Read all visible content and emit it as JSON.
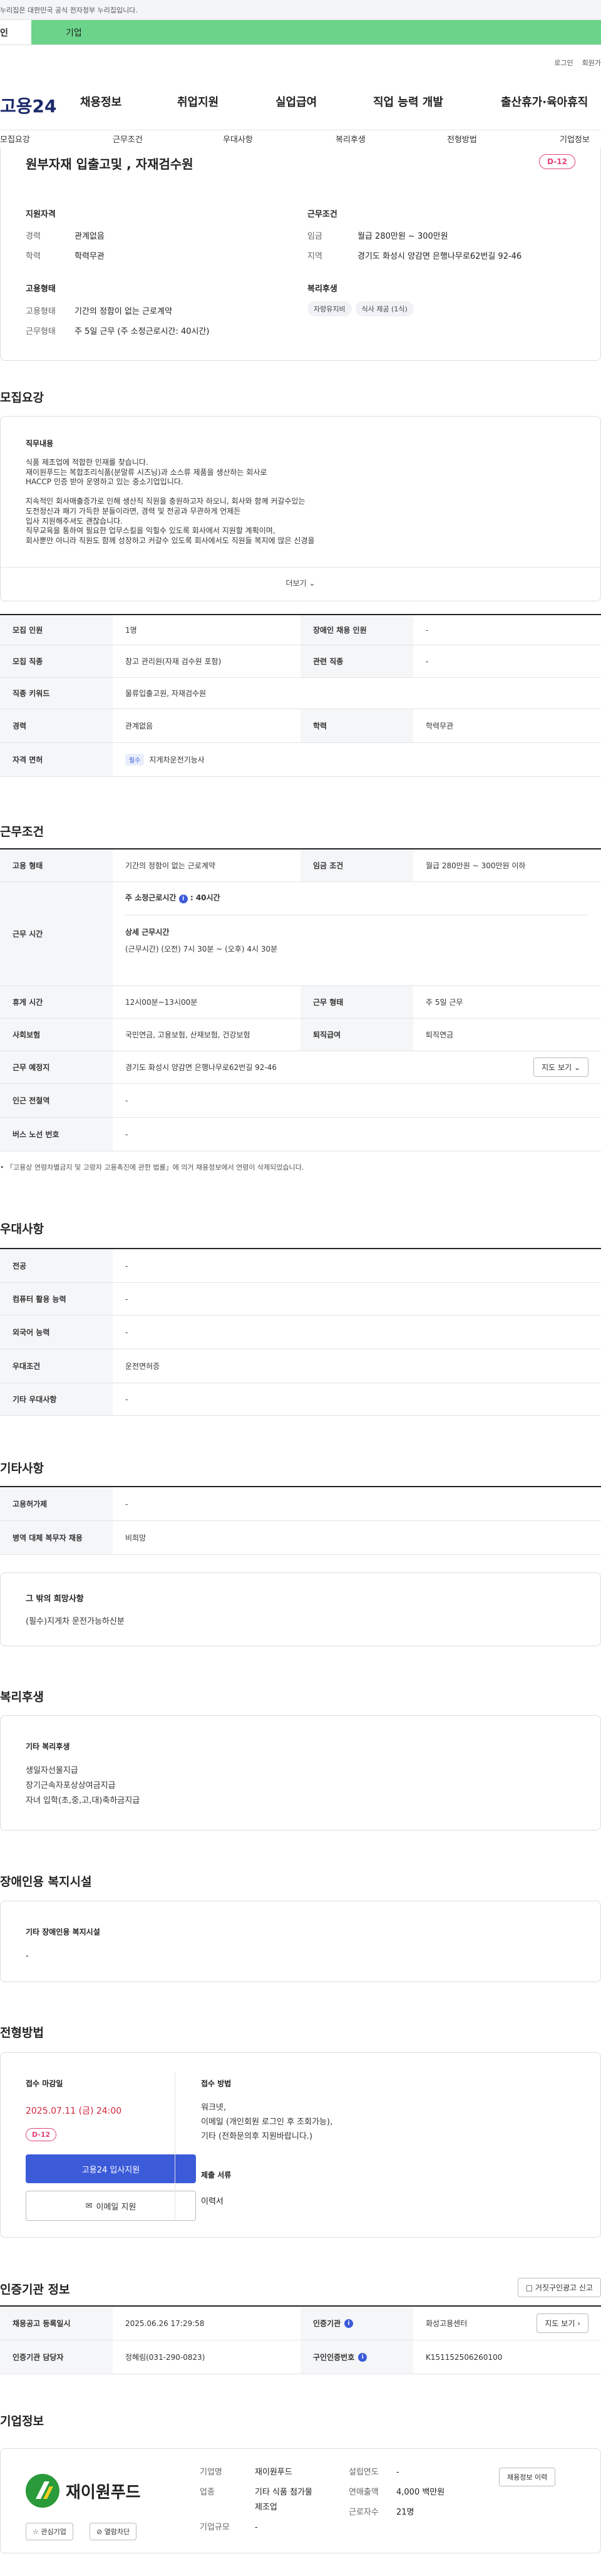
{
  "notice": "누리집은 대한민국 공식 전자정부 누리집입니다.",
  "gbar": {
    "tab_personal": "인",
    "tab_company": "기업"
  },
  "util": {
    "login": "로그인",
    "join": "회원가"
  },
  "gnb": {
    "logo": "고용24",
    "menu": [
      "채용정보",
      "취업지원",
      "실업급여",
      "직업 능력 개발",
      "출산휴가·육아휴직"
    ]
  },
  "tabs": [
    "모집요강",
    "근무조건",
    "우대사항",
    "복리후생",
    "전형방법",
    "기업정보"
  ],
  "job": {
    "title": "원부자재 입출고및 , 자재검수원",
    "dday": "D-12",
    "qual_title": "지원자격",
    "exp_label": "경력",
    "exp_value": "관계없음",
    "edu_label": "학력",
    "edu_value": "학력무관",
    "cond_title": "근무조건",
    "pay_label": "임금",
    "pay_value": "월급 280만원 ~ 300만원",
    "area_label": "지역",
    "area_value": "경기도 화성시 양감면 은행나무로62번길 92-46",
    "emp_title": "고용형태",
    "emptype_label": "고용형태",
    "emptype_value": "기간의 정함이 없는 근로계약",
    "worktype_label": "근무형태",
    "worktype_value": "주 5일 근무 (주 소정근로시간: 40시간)",
    "welfare_title": "복리후생",
    "welfare_chips": [
      "자량유지비",
      "식사 제공 (1식)"
    ]
  },
  "recruit": {
    "title": "모집요강",
    "duty_title": "직무내용",
    "duty_lines": [
      "식품 제조업에 적합한 인재를 찾습니다.",
      "재이원푸드는 복합조리식품(분말류 시즈닝)과 소스류 제품을 생산하는 회사로",
      "HACCP 인증 받아 운영하고 있는 중소기업입니다.",
      "",
      "지속적인 회사매출증가로  인해 생산직 직원을 충원하고자 하오니, 회사와 함께 커갈수있는",
      "도전정신과 패기 가득한 분들이라면, 경력 및 전공과 무관하게 언제든",
      "입사 지원해주셔도 괜찮습니다.",
      "직무교육을 통하여 필요한 업무스킬을 익힐수 있도록 회사에서 지원할 계획이며,",
      "회사뿐만 아니라 직원도 함께 성장하고 커갈수 있도록 회사에서도 직원들 복지에 많은 신경을"
    ],
    "more": "더보기",
    "rows": [
      {
        "k1": "모집 인원",
        "v1": "1명",
        "k2": "장애인 채용 인원",
        "v2": "-"
      },
      {
        "k1": "모집 직종",
        "v1": "창고 관리원(자재 검수원 포함)",
        "k2": "관련 직종",
        "v2": "-"
      },
      {
        "k1": "직종 키워드",
        "v1": "물류입출고원, 자재검수원"
      },
      {
        "k1": "경력",
        "v1": "관계없음",
        "k2": "학력",
        "v2": "학력무관"
      },
      {
        "k1": "자격 면허",
        "badge": "필수",
        "v1": "지게차운전기능사"
      }
    ]
  },
  "cond": {
    "title": "근무조건",
    "emptype_k": "고용 형태",
    "emptype_v": "기간의 정함이 없는 근로계약",
    "pay_k": "임금 조건",
    "pay_v": "월급 280만원 ~ 300만원 이하",
    "time_k": "근무 시간",
    "time_weekly_label": "주 소정근로시간",
    "time_weekly_v": "40시간",
    "time_detail_title": "상세 근무시간",
    "time_detail_v": "(근무시간) (오전) 7시 30분 ~ (오후) 4시 30분",
    "rest_k": "휴게 시간",
    "rest_v": "12시00분~13시00분",
    "form_k": "근무 형태",
    "form_v": "주 5일 근무",
    "ins_k": "사회보험",
    "ins_v": "국민연금, 고용보험, 산재보험, 건강보험",
    "retire_k": "퇴직급여",
    "retire_v": "퇴직연금",
    "place_k": "근무 예정지",
    "place_v": "경기도 화성시 양감면 은행나무로62번길 92-46",
    "map_btn": "지도 보기",
    "subway_k": "인근 전철역",
    "subway_v": "-",
    "bus_k": "버스 노선 번호",
    "bus_v": "-",
    "footnote": "「고용상 연령차별금지 및 고령자 고용촉진에 관한 법률」에 의거 채용정보에서 연령이 삭제되었습니다."
  },
  "pref": {
    "title": "우대사항",
    "rows": [
      {
        "k": "전공",
        "v": "-"
      },
      {
        "k": "컴퓨터 활용 능력",
        "v": "-"
      },
      {
        "k": "외국어 능력",
        "v": "-"
      },
      {
        "k": "우대조건",
        "v": "운전면허증"
      },
      {
        "k": "기타 우대사항",
        "v": "-"
      }
    ]
  },
  "etc": {
    "title": "기타사항",
    "rows": [
      {
        "k": "고용허가제",
        "v": "-"
      },
      {
        "k": "병역 대체 복무자 채용",
        "v": "비희망"
      }
    ],
    "wish_title": "그 밖의 희망사항",
    "wish_v": "(필수)지게차 운전가능하신분"
  },
  "welfare": {
    "title": "복리후생",
    "sub_title": "기타 복리후생",
    "lines": [
      "생일자선물지급",
      "장기근속자포상상여금지급",
      "자녀 입학(초,중,고,대)축하금지급"
    ]
  },
  "disabled": {
    "title": "장애인용 복지시설",
    "sub_title": "기타 장애인용 복지시설",
    "v": "-"
  },
  "process": {
    "title": "전형방법",
    "deadline_label": "접수 마감일",
    "deadline": "2025.07.11 (금) 24:00",
    "dday": "D-12",
    "apply_btn": "고용24 입사지원",
    "email_btn": "이메일 지원",
    "method_label": "접수 방법",
    "method_lines": [
      "워크넷,",
      "이메일 (개인회원 로그인 후 조회가능),",
      "기타 (전화문의후 지원바랍니다.)"
    ],
    "docs_label": "제출 서류",
    "docs_v": "이력서"
  },
  "cert": {
    "title": "인증기관 정보",
    "report_btn": "거짓구인광고 신고",
    "rows": [
      {
        "k1": "채용공고 등록일시",
        "v1": "2025.06.26 17:29:58",
        "k2": "인증기관",
        "v2": "화성고용센터",
        "btn": "지도 보기"
      },
      {
        "k1": "인증기관 담당자",
        "v1": "정혜림(031-290-0823)",
        "k2": "구인인증번호",
        "v2": "K151152506260100"
      }
    ]
  },
  "company": {
    "title": "기업정보",
    "logo_text": "재이원푸드",
    "fav_btn": "관심기업",
    "block_btn": "열람차단",
    "name_k": "기업명",
    "name_v": "재이원푸드",
    "ind_k": "업종",
    "ind_v1": "기타 식품 첨가물",
    "ind_v2": "제조업",
    "size_k": "기업규모",
    "size_v": "-",
    "found_k": "설립연도",
    "found_v": "-",
    "sales_k": "연매출액",
    "sales_v": "4,000 백만원",
    "emp_k": "근로자수",
    "emp_v": "21명",
    "jobs_btn": "채용정보 이력"
  },
  "colors": {
    "accent": "#3c5bd9",
    "dday": "#e0427a",
    "green": "#6bd48a",
    "brand": "#1b2a6b"
  }
}
